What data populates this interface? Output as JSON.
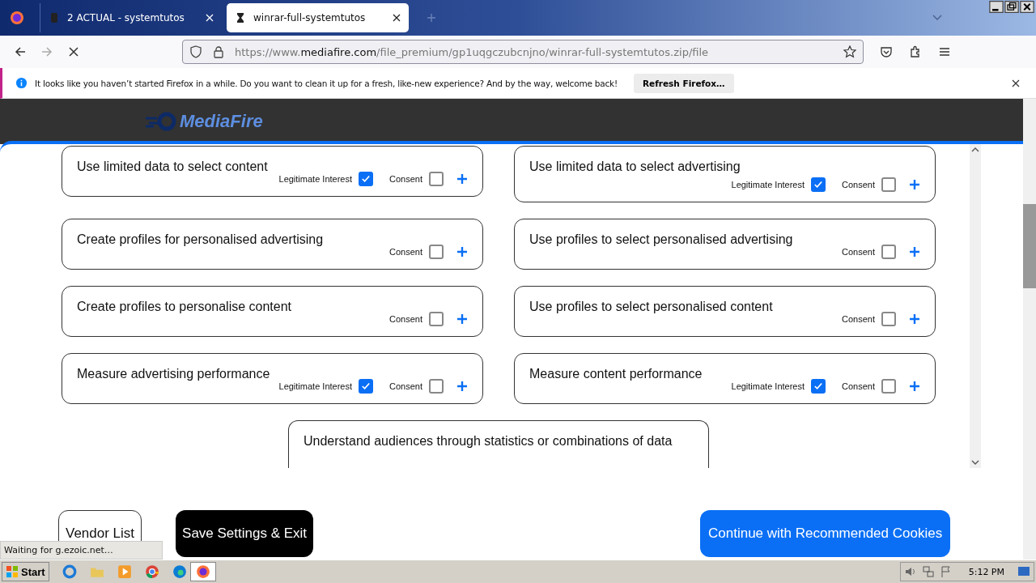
{
  "tabs": [
    {
      "label": "2 ACTUAL - systemtutos",
      "selected": false
    },
    {
      "label": "winrar-full-systemtutos",
      "selected": true
    }
  ],
  "address": {
    "prefix": "https://www.",
    "domain": "mediafire.com",
    "path": "/file_premium/gp1uqgczubcnjno/winrar-full-systemtutos.zip/file"
  },
  "notification": {
    "message": "It looks like you haven’t started Firefox in a while. Do you want to clean it up for a fresh, like-new experience? And by the way, welcome back!",
    "button": "Refresh Firefox…"
  },
  "site": {
    "logo": "MediaFire"
  },
  "purposes": [
    {
      "title": "Use limited data to select content",
      "legitimate_interest": {
        "label": "Legitimate Interest",
        "checked": true
      },
      "consent": {
        "label": "Consent",
        "checked": false
      }
    },
    {
      "title": "Use limited data to select advertising",
      "legitimate_interest": {
        "label": "Legitimate Interest",
        "checked": true
      },
      "consent": {
        "label": "Consent",
        "checked": false
      }
    },
    {
      "title": "Create profiles for personalised advertising",
      "consent": {
        "label": "Consent",
        "checked": false
      }
    },
    {
      "title": "Use profiles to select personalised advertising",
      "consent": {
        "label": "Consent",
        "checked": false
      }
    },
    {
      "title": "Create profiles to personalise content",
      "consent": {
        "label": "Consent",
        "checked": false
      }
    },
    {
      "title": "Use profiles to select personalised content",
      "consent": {
        "label": "Consent",
        "checked": false
      }
    },
    {
      "title": "Measure advertising performance",
      "legitimate_interest": {
        "label": "Legitimate Interest",
        "checked": true
      },
      "consent": {
        "label": "Consent",
        "checked": false
      }
    },
    {
      "title": "Measure content performance",
      "legitimate_interest": {
        "label": "Legitimate Interest",
        "checked": true
      },
      "consent": {
        "label": "Consent",
        "checked": false
      }
    }
  ],
  "partial_purpose": {
    "title": "Understand audiences through statistics or combinations of data"
  },
  "buttons": [
    {
      "label": "Vendor List",
      "kind": "outline"
    },
    {
      "label": "Save Settings & Exit",
      "kind": "dark"
    },
    {
      "label": "Continue with Recommended Cookies",
      "kind": "primary"
    }
  ],
  "status": "Waiting for g.ezoic.net…",
  "taskbar": {
    "start": "Start",
    "clock": "5:12 PM"
  }
}
